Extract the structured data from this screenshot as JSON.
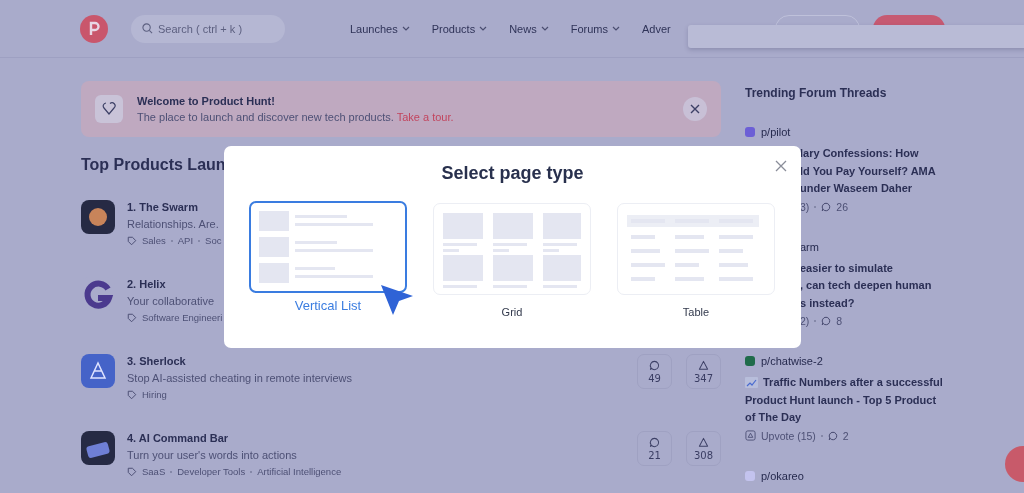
{
  "header": {
    "search": {
      "placeholder": "Search ( ctrl + k )"
    },
    "nav": [
      {
        "label": "Launches",
        "has_caret": true
      },
      {
        "label": "Products",
        "has_caret": true
      },
      {
        "label": "News",
        "has_caret": true
      },
      {
        "label": "Forums",
        "has_caret": true
      },
      {
        "label": "Adver",
        "has_caret": false
      }
    ]
  },
  "banner": {
    "title": "Welcome to Product Hunt!",
    "text": "The place to launch and discover new tech products.",
    "link": "Take a tour."
  },
  "products": {
    "heading": "Top Products Laun",
    "items": [
      {
        "kind": "swarm",
        "name": "1. The Swarm",
        "tagline": "Relationships. Are.",
        "tags": [
          "Sales",
          "API",
          "Soc"
        ]
      },
      {
        "kind": "helix",
        "name": "2. Helix",
        "tagline": "Your collaborative",
        "tags": [
          "Software Engineeri"
        ]
      },
      {
        "kind": "sherlock",
        "name": "3. Sherlock",
        "tagline": "Stop AI-assisted cheating in remote interviews",
        "tags": [
          "Hiring"
        ],
        "comments": "49",
        "upvotes": "347"
      },
      {
        "kind": "commandbar",
        "name": "4. AI Command Bar",
        "tagline": "Turn your user's words into actions",
        "tags": [
          "SaaS",
          "Developer Tools",
          "Artificial Intelligence"
        ],
        "comments": "21",
        "upvotes": "308"
      }
    ]
  },
  "forum": {
    "heading": "Trending Forum Threads",
    "threads": [
      {
        "source": "p/pilot",
        "color": "#6c5fd6",
        "source_covered": false,
        "body_covered": true,
        "title_lines": [
          "lary Confessions: How",
          "ld You Pay Yourself? AMA",
          "under Waseem Daher"
        ],
        "upvote_label": "3)",
        "comments": "26"
      },
      {
        "source": "arm",
        "source_covered": true,
        "body_covered": true,
        "title_lines": [
          "easier to simulate",
          ", can tech deepen human",
          "s instead?"
        ],
        "upvote_label": "2)",
        "comments": "8"
      },
      {
        "source": "p/chatwise-2",
        "color": "#1f6b4a",
        "source_covered": false,
        "body_covered": false,
        "chart_icon": true,
        "title_lines": [
          "Traffic Numbers after a successful",
          "Product Hunt launch - Top 5 Product",
          "of The Day"
        ],
        "upvote_label": "Upvote (15)",
        "comments": "2"
      },
      {
        "source": "p/okareo",
        "color": "#c3c3ee",
        "source_covered": false
      }
    ]
  },
  "modal": {
    "title": "Select page type",
    "options": [
      {
        "label": "Vertical List",
        "kind": "list",
        "selected": true
      },
      {
        "label": "Grid",
        "kind": "grid",
        "selected": false
      },
      {
        "label": "Table",
        "kind": "table",
        "selected": false
      }
    ]
  }
}
